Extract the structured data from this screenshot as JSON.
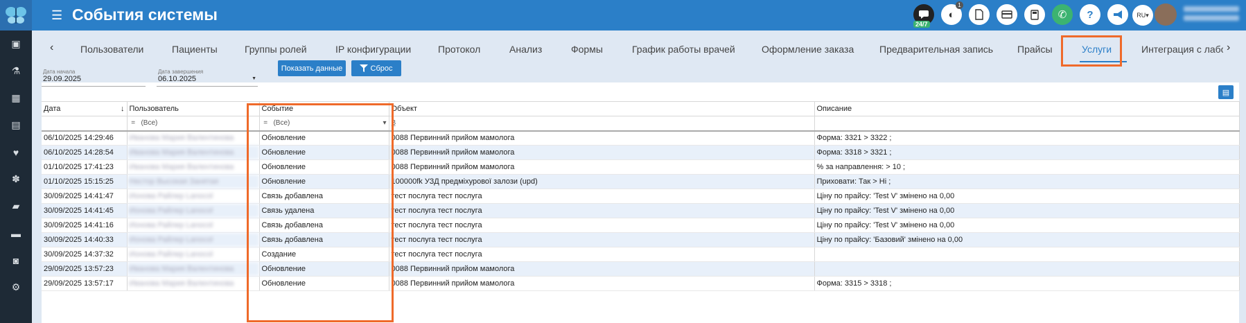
{
  "app": {
    "title": "События системы"
  },
  "topbar": {
    "support_badge": "24/7",
    "notif_count": "1",
    "lang": "RU",
    "icons": [
      "chat-icon",
      "voice-icon",
      "pdf-icon",
      "card-icon",
      "calculator-icon",
      "phone-icon",
      "help-icon",
      "megaphone-icon"
    ]
  },
  "sidebar": {
    "icons": [
      "id-card-icon",
      "flask-icon",
      "calendar-icon",
      "document-icon",
      "heart-pulse-icon",
      "gears-icon",
      "book-icon",
      "folder-icon",
      "money-icon",
      "settings-icon"
    ]
  },
  "tabs": [
    {
      "label": "Пользователи"
    },
    {
      "label": "Пациенты"
    },
    {
      "label": "Группы ролей"
    },
    {
      "label": "IP конфигурации"
    },
    {
      "label": "Протокол"
    },
    {
      "label": "Анализ"
    },
    {
      "label": "Формы"
    },
    {
      "label": "График работы врачей"
    },
    {
      "label": "Оформление заказа"
    },
    {
      "label": "Предварительная запись"
    },
    {
      "label": "Прайсы"
    },
    {
      "label": "Услуги"
    },
    {
      "label": "Интеграция с лабо"
    }
  ],
  "filters": {
    "start_label": "Дата начала",
    "start_value": "29.09.2025",
    "end_label": "Дата завершения",
    "end_value": "06.10.2025",
    "show_button": "Показать данные",
    "reset_button": "Сброс"
  },
  "grid": {
    "columns": [
      "Дата",
      "Пользователь",
      "Событие",
      "Объект",
      "Описание"
    ],
    "filter_all": "(Все)",
    "filter_eq": "=",
    "filter_b": "B̲",
    "rows": [
      {
        "date": "06/10/2025 14:29:46",
        "user": "Иванова Мария Валентинова",
        "event": "Обновление",
        "object": "0088 Первинний прийом мамолога",
        "desc": "Форма: 3321 > 3322 ;"
      },
      {
        "date": "06/10/2025 14:28:54",
        "user": "Иванова Мария Валентинова",
        "event": "Обновление",
        "object": "0088 Первинний прийом мамолога",
        "desc": "Форма: 3318 > 3321 ;"
      },
      {
        "date": "01/10/2025 17:41:23",
        "user": "Иванова Мария Валентинова",
        "event": "Обновление",
        "object": "0088 Первинний прийом мамолога",
        "desc": "% за направлення: > 10 ;"
      },
      {
        "date": "01/10/2025 15:15:25",
        "user": "Нестор Высокая Занятая",
        "event": "Обновление",
        "object": "100000fk УЗД предміхурової залози (upd)",
        "desc": "Приховати: Так > Ні ;"
      },
      {
        "date": "30/09/2025 14:41:47",
        "user": "Ионова Райлер Lanocol",
        "event": "Связь добавлена",
        "object": "тест послуга тест послуга",
        "desc": "Ціну по прайсу: 'Test V' змінено на 0,00"
      },
      {
        "date": "30/09/2025 14:41:45",
        "user": "Ионова Райлер Lanocol",
        "event": "Связь удалена",
        "object": "тест послуга тест послуга",
        "desc": "Ціну по прайсу: 'Test V' змінено на 0,00"
      },
      {
        "date": "30/09/2025 14:41:16",
        "user": "Ионова Райлер Lanocol",
        "event": "Связь добавлена",
        "object": "тест послуга тест послуга",
        "desc": "Ціну по прайсу: 'Test V' змінено на 0,00"
      },
      {
        "date": "30/09/2025 14:40:33",
        "user": "Ионова Райлер Lanocol",
        "event": "Связь добавлена",
        "object": "тест послуга тест послуга",
        "desc": "Ціну по прайсу: 'Базовий' змінено на 0,00"
      },
      {
        "date": "30/09/2025 14:37:32",
        "user": "Ионова Райлер Lanocol",
        "event": "Создание",
        "object": "тест послуга тест послуга",
        "desc": ""
      },
      {
        "date": "29/09/2025 13:57:23",
        "user": "Иванова Мария Валентинова",
        "event": "Обновление",
        "object": "0088 Первинний прийом мамолога",
        "desc": ""
      },
      {
        "date": "29/09/2025 13:57:17",
        "user": "Иванова Мария Валентинова",
        "event": "Обновление",
        "object": "0088 Первинний прийом мамолога",
        "desc": "Форма: 3315 > 3318 ;"
      }
    ]
  },
  "colors": {
    "brand": "#2b7fc8",
    "sidebar": "#1e2a36",
    "highlight": "#ef6a2a"
  }
}
